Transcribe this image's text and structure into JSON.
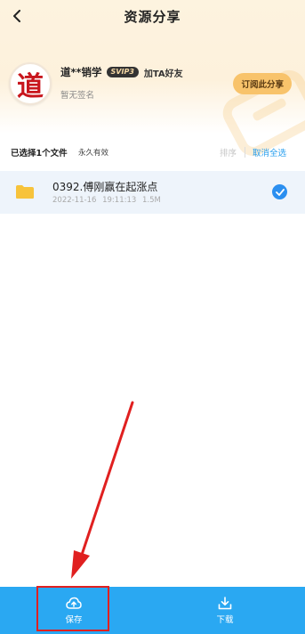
{
  "nav": {
    "title": "资源分享"
  },
  "profile": {
    "avatar_char": "道",
    "name": "道**销学",
    "vip_badge": "SVIP3",
    "add_friend": "加TA好友",
    "signature": "暂无签名",
    "subscribe_label": "订阅此分享"
  },
  "selection": {
    "count_text": "已选择1个文件",
    "validity": "永久有效",
    "sort_label": "排序",
    "deselect_label": "取消全选"
  },
  "files": [
    {
      "name": "0392.傅刚赢在起涨点",
      "date": "2022-11-16",
      "time": "19:11:13",
      "size": "1.5M",
      "selected": true
    }
  ],
  "bottom_bar": {
    "save_label": "保存",
    "download_label": "下载"
  },
  "colors": {
    "accent_blue": "#2aa8f2",
    "check_blue": "#2b8ff0",
    "subscribe_gold": "#f8c36b",
    "folder_yellow": "#f7c33b",
    "annotation_red": "#e02020"
  },
  "icons": {
    "back": "chevron-left-icon",
    "folder": "folder-icon",
    "check": "check-circle-icon",
    "save": "cloud-upload-icon",
    "download": "download-icon"
  }
}
